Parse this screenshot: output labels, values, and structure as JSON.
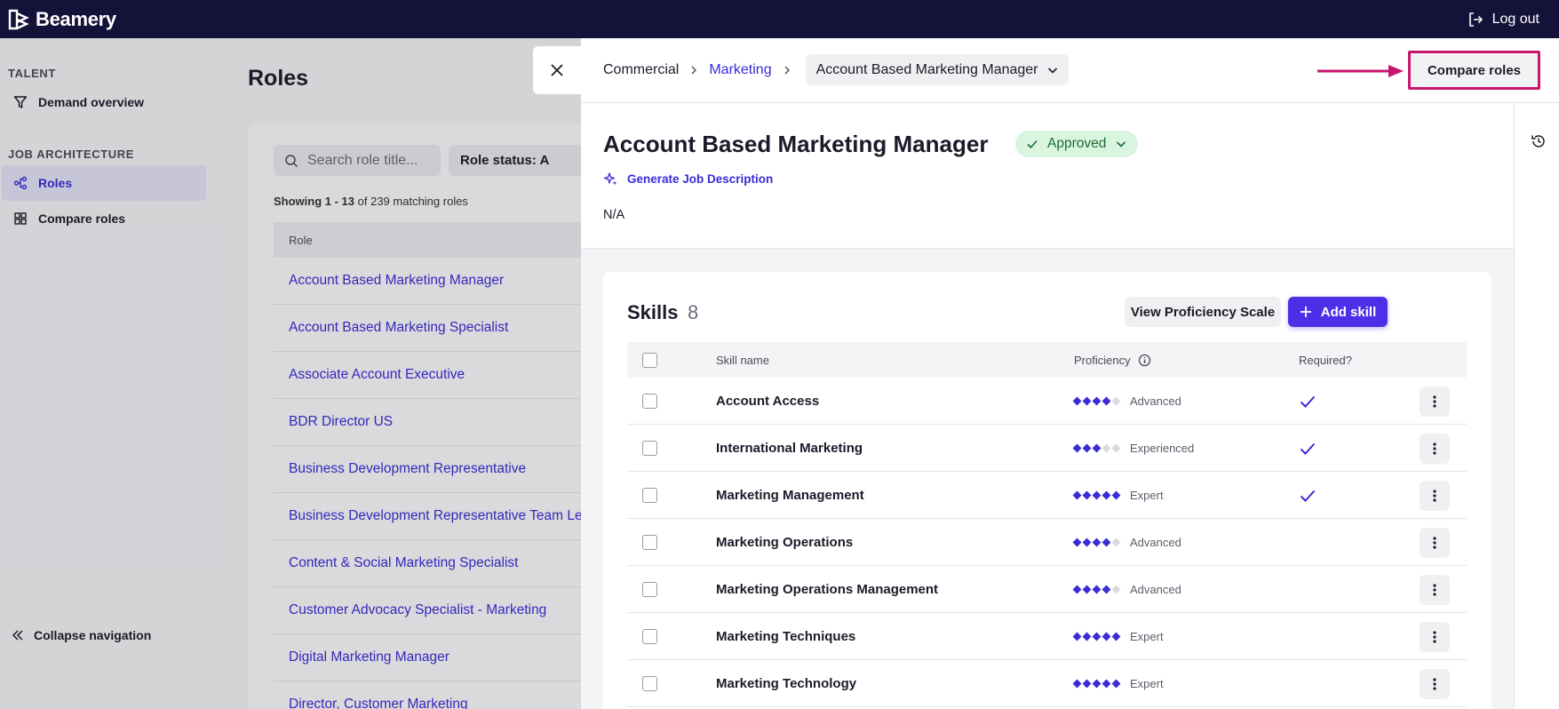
{
  "topbar": {
    "brand": "Beamery",
    "logout_label": "Log out"
  },
  "sidebar": {
    "sections": [
      {
        "title": "TALENT",
        "items": [
          {
            "label": "Demand overview",
            "icon": "filter-icon"
          }
        ]
      },
      {
        "title": "JOB ARCHITECTURE",
        "items": [
          {
            "label": "Roles",
            "icon": "hierarchy-icon",
            "active": true
          },
          {
            "label": "Compare roles",
            "icon": "grid-icon"
          }
        ]
      }
    ],
    "collapse_label": "Collapse navigation"
  },
  "roles_page": {
    "title": "Roles",
    "search_placeholder": "Search role title...",
    "status_filter_label": "Role status: A",
    "showing_range": "Showing 1 - 13",
    "showing_total": "of 239 matching roles",
    "column_header": "Role",
    "roles": [
      "Account Based Marketing Manager",
      "Account Based Marketing Specialist",
      "Associate Account Executive",
      "BDR Director US",
      "Business Development Representative",
      "Business Development Representative Team Lead",
      "Content & Social Marketing Specialist",
      "Customer Advocacy Specialist - Marketing",
      "Digital Marketing Manager",
      "Director, Customer Marketing"
    ]
  },
  "panel": {
    "breadcrumb": {
      "level1": "Commercial",
      "level2": "Marketing",
      "current": "Account Based Marketing Manager"
    },
    "compare_roles_label": "Compare roles",
    "role_title": "Account Based Marketing Manager",
    "status_label": "Approved",
    "generate_jd_label": "Generate Job Description",
    "description": "N/A",
    "skills": {
      "title": "Skills",
      "count": "8",
      "view_scale_label": "View Proficiency Scale",
      "add_skill_label": "Add skill",
      "columns": {
        "name": "Skill name",
        "proficiency": "Proficiency",
        "required": "Required?"
      },
      "rows": [
        {
          "name": "Account Access",
          "level": 4,
          "level_label": "Advanced",
          "required": true
        },
        {
          "name": "International Marketing",
          "level": 3,
          "level_label": "Experienced",
          "required": true
        },
        {
          "name": "Marketing Management",
          "level": 5,
          "level_label": "Expert",
          "required": true
        },
        {
          "name": "Marketing Operations",
          "level": 4,
          "level_label": "Advanced",
          "required": false
        },
        {
          "name": "Marketing Operations Management",
          "level": 4,
          "level_label": "Advanced",
          "required": false
        },
        {
          "name": "Marketing Techniques",
          "level": 5,
          "level_label": "Expert",
          "required": false
        },
        {
          "name": "Marketing Technology",
          "level": 5,
          "level_label": "Expert",
          "required": false
        }
      ]
    }
  },
  "colors": {
    "topbar_bg": "#15123a",
    "accent": "#3b2bd6",
    "primary_button": "#4b30e8",
    "highlight_border": "#c8156e",
    "approved_bg": "#d9f5e0"
  }
}
